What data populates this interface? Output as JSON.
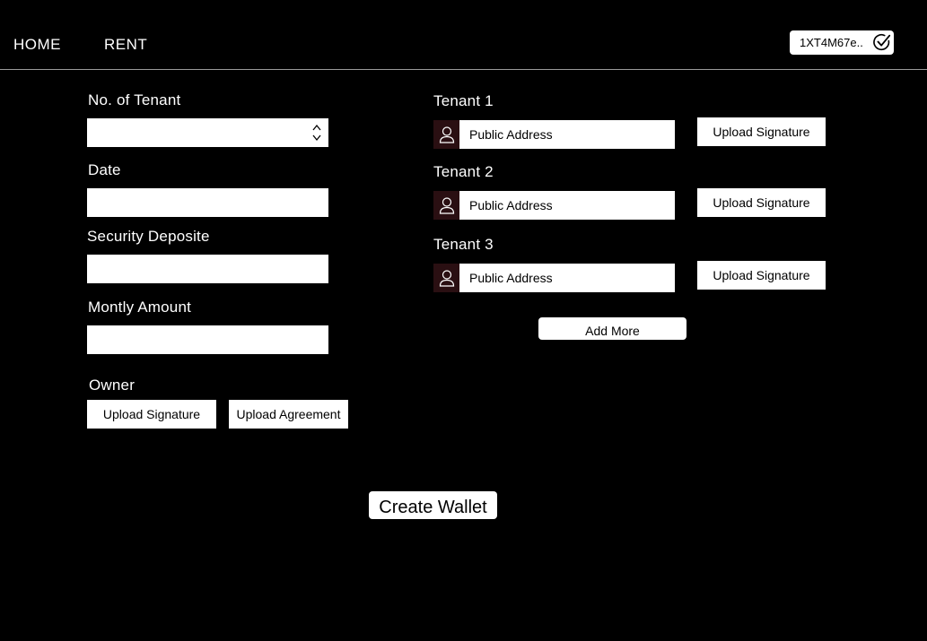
{
  "nav": {
    "home_label": "HOME",
    "rent_label": "RENT"
  },
  "wallet": {
    "address_short": "1XT4M67e..",
    "status_icon": "check-circle-icon"
  },
  "form": {
    "num_tenant_label": "No. of Tenant",
    "date_label": "Date",
    "security_deposit_label": "Security Deposite",
    "monthly_amount_label": "Montly Amount",
    "owner_label": "Owner",
    "owner_upload_signature": "Upload Signature",
    "owner_upload_agreement": "Upload Agreement"
  },
  "tenants": [
    {
      "label": "Tenant  1",
      "address_placeholder": "Public Address",
      "upload_label": "Upload Signature",
      "icon": "user-icon"
    },
    {
      "label": "Tenant  2",
      "address_placeholder": "Public Address",
      "upload_label": "Upload Signature",
      "icon": "user-icon"
    },
    {
      "label": "Tenant  3",
      "address_placeholder": "Public Address",
      "upload_label": "Upload Signature",
      "icon": "user-icon"
    }
  ],
  "actions": {
    "add_more_label": "Add More",
    "create_wallet_label": "Create Wallet"
  },
  "colors": {
    "background": "#000000",
    "foreground": "#ffffff",
    "icon_bg": "#2a0f12",
    "divider": "#9a9a9a"
  }
}
